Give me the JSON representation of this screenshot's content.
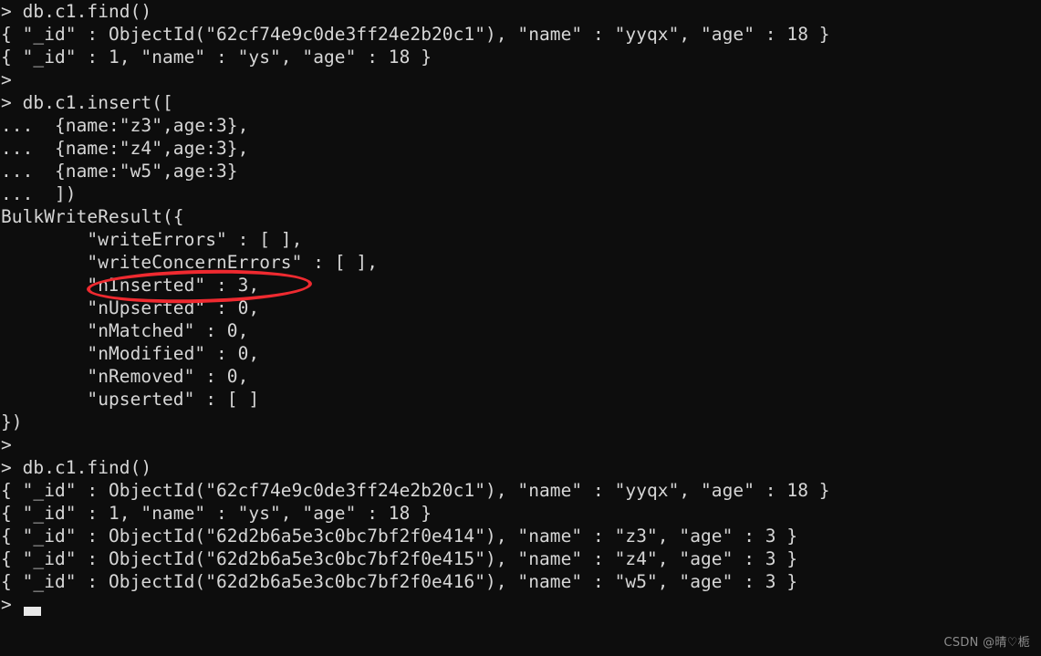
{
  "terminal": {
    "app": "mongo-shell",
    "background_color": "#0d0d0d",
    "text_color": "#d6d6d6",
    "prompt": ">",
    "continuation_prompt": "...",
    "lines": [
      "> db.c1.find()",
      "{ \"_id\" : ObjectId(\"62cf74e9c0de3ff24e2b20c1\"), \"name\" : \"yyqx\", \"age\" : 18 }",
      "{ \"_id\" : 1, \"name\" : \"ys\", \"age\" : 18 }",
      ">",
      "> db.c1.insert([",
      "...  {name:\"z3\",age:3},",
      "...  {name:\"z4\",age:3},",
      "...  {name:\"w5\",age:3}",
      "...  ])",
      "BulkWriteResult({",
      "        \"writeErrors\" : [ ],",
      "        \"writeConcernErrors\" : [ ],",
      "        \"nInserted\" : 3,",
      "        \"nUpserted\" : 0,",
      "        \"nMatched\" : 0,",
      "        \"nModified\" : 0,",
      "        \"nRemoved\" : 0,",
      "        \"upserted\" : [ ]",
      "})",
      ">",
      "> db.c1.find()",
      "{ \"_id\" : ObjectId(\"62cf74e9c0de3ff24e2b20c1\"), \"name\" : \"yyqx\", \"age\" : 18 }",
      "{ \"_id\" : 1, \"name\" : \"ys\", \"age\" : 18 }",
      "{ \"_id\" : ObjectId(\"62d2b6a5e3c0bc7bf2f0e414\"), \"name\" : \"z3\", \"age\" : 3 }",
      "{ \"_id\" : ObjectId(\"62d2b6a5e3c0bc7bf2f0e415\"), \"name\" : \"z4\", \"age\" : 3 }",
      "{ \"_id\" : ObjectId(\"62d2b6a5e3c0bc7bf2f0e416\"), \"name\" : \"w5\", \"age\" : 3 }",
      ">"
    ]
  },
  "annotation": {
    "shape": "ellipse",
    "color": "#ef2a30",
    "stroke_width": 4,
    "targets_text": "\"nInserted\" : 3,"
  },
  "watermark": {
    "text": "CSDN @晴♡栀",
    "color": "#8d8d8d"
  }
}
